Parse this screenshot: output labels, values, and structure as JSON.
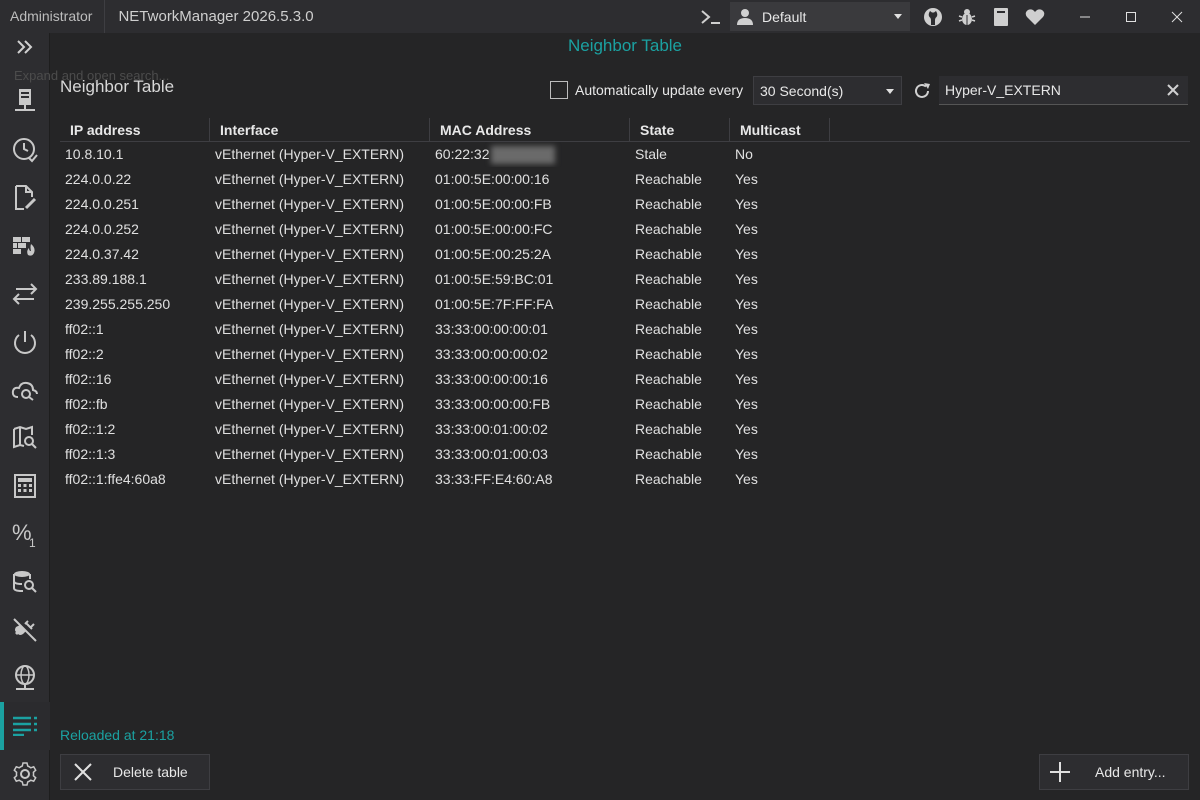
{
  "titlebar": {
    "admin_label": "Administrator",
    "app_title": "NETworkManager 2026.5.3.0",
    "profile": "Default",
    "icons": [
      "powershell-icon",
      "user-icon",
      "github-icon",
      "bug-icon",
      "book-icon",
      "heart-icon",
      "minimize-icon",
      "maximize-icon",
      "close-icon"
    ]
  },
  "sidebar": {
    "expand_tooltip": "Expand and open search...",
    "items": [
      "network-interface-icon",
      "history-icon",
      "file-edit-icon",
      "firewall-icon",
      "transfer-icon",
      "power-icon",
      "cloud-search-icon",
      "map-search-icon",
      "calculator-icon",
      "subnet-percent-icon",
      "database-search-icon",
      "plug-disconnect-icon",
      "web-icon",
      "list-icon",
      "settings-icon"
    ],
    "active": "list-icon"
  },
  "view": {
    "header": "Neighbor Table",
    "section_title": "Neighbor Table",
    "auto_update_label": "Automatically update every",
    "auto_update_checked": false,
    "interval": "30 Second(s)",
    "search_value": "Hyper-V_EXTERN"
  },
  "table": {
    "columns": [
      "IP address",
      "Interface",
      "MAC Address",
      "State",
      "Multicast"
    ],
    "rows": [
      [
        "10.8.10.1",
        "vEthernet (Hyper-V_EXTERN)",
        "60:22:32",
        "Stale",
        "No"
      ],
      [
        "224.0.0.22",
        "vEthernet (Hyper-V_EXTERN)",
        "01:00:5E:00:00:16",
        "Reachable",
        "Yes"
      ],
      [
        "224.0.0.251",
        "vEthernet (Hyper-V_EXTERN)",
        "01:00:5E:00:00:FB",
        "Reachable",
        "Yes"
      ],
      [
        "224.0.0.252",
        "vEthernet (Hyper-V_EXTERN)",
        "01:00:5E:00:00:FC",
        "Reachable",
        "Yes"
      ],
      [
        "224.0.37.42",
        "vEthernet (Hyper-V_EXTERN)",
        "01:00:5E:00:25:2A",
        "Reachable",
        "Yes"
      ],
      [
        "233.89.188.1",
        "vEthernet (Hyper-V_EXTERN)",
        "01:00:5E:59:BC:01",
        "Reachable",
        "Yes"
      ],
      [
        "239.255.255.250",
        "vEthernet (Hyper-V_EXTERN)",
        "01:00:5E:7F:FF:FA",
        "Reachable",
        "Yes"
      ],
      [
        "ff02::1",
        "vEthernet (Hyper-V_EXTERN)",
        "33:33:00:00:00:01",
        "Reachable",
        "Yes"
      ],
      [
        "ff02::2",
        "vEthernet (Hyper-V_EXTERN)",
        "33:33:00:00:00:02",
        "Reachable",
        "Yes"
      ],
      [
        "ff02::16",
        "vEthernet (Hyper-V_EXTERN)",
        "33:33:00:00:00:16",
        "Reachable",
        "Yes"
      ],
      [
        "ff02::fb",
        "vEthernet (Hyper-V_EXTERN)",
        "33:33:00:00:00:FB",
        "Reachable",
        "Yes"
      ],
      [
        "ff02::1:2",
        "vEthernet (Hyper-V_EXTERN)",
        "33:33:00:01:00:02",
        "Reachable",
        "Yes"
      ],
      [
        "ff02::1:3",
        "vEthernet (Hyper-V_EXTERN)",
        "33:33:00:01:00:03",
        "Reachable",
        "Yes"
      ],
      [
        "ff02::1:ffe4:60a8",
        "vEthernet (Hyper-V_EXTERN)",
        "33:33:FF:E4:60:A8",
        "Reachable",
        "Yes"
      ]
    ]
  },
  "footer": {
    "status": "Reloaded at 21:18",
    "delete_label": "Delete table",
    "add_label": "Add entry..."
  },
  "colors": {
    "accent": "#1ba1a1",
    "background": "#252526",
    "chrome": "#2d2d30"
  }
}
